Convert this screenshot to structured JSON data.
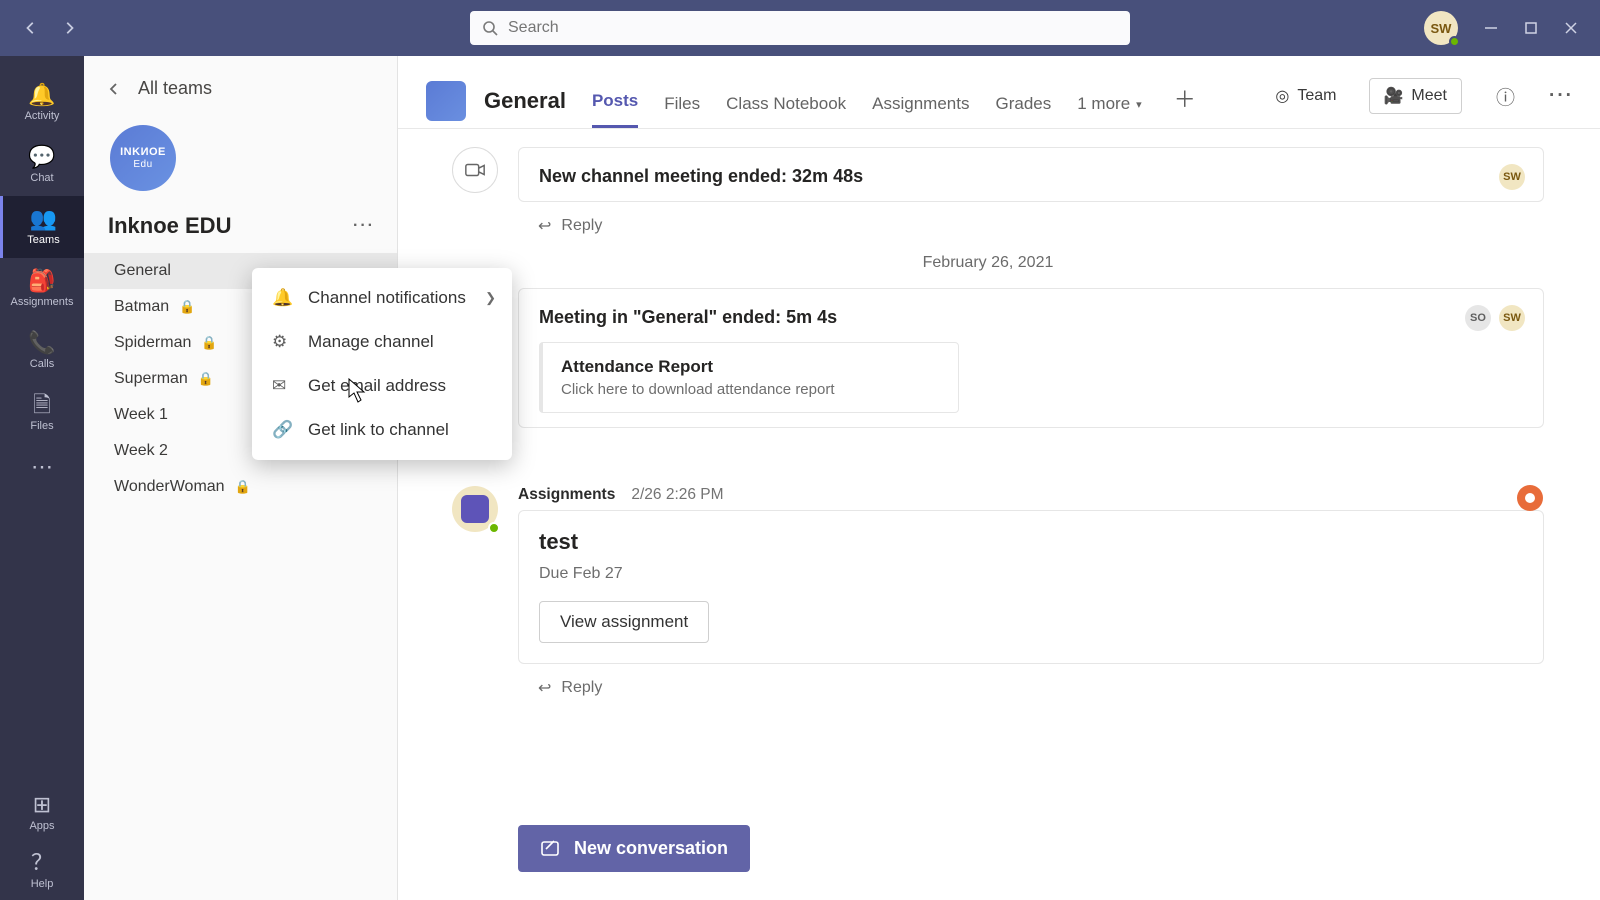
{
  "titlebar": {
    "search_placeholder": "Search",
    "avatar_initials": "SW"
  },
  "rail": {
    "activity": "Activity",
    "chat": "Chat",
    "teams": "Teams",
    "assignments": "Assignments",
    "calls": "Calls",
    "files": "Files",
    "apps": "Apps",
    "help": "Help"
  },
  "pane": {
    "all_teams": "All teams",
    "team_logo_top": "INKИOE",
    "team_logo_bottom": "Edu",
    "team_name": "Inknoe EDU"
  },
  "channels": [
    {
      "name": "General",
      "locked": false,
      "selected": true
    },
    {
      "name": "Batman",
      "locked": true,
      "selected": false
    },
    {
      "name": "Spiderman",
      "locked": true,
      "selected": false
    },
    {
      "name": "Superman",
      "locked": true,
      "selected": false
    },
    {
      "name": "Week 1",
      "locked": false,
      "selected": false
    },
    {
      "name": "Week 2",
      "locked": false,
      "selected": false
    },
    {
      "name": "WonderWoman",
      "locked": true,
      "selected": false
    }
  ],
  "context_menu": [
    {
      "icon": "bell",
      "label": "Channel notifications",
      "submenu": true
    },
    {
      "icon": "gear",
      "label": "Manage channel",
      "submenu": false
    },
    {
      "icon": "mail",
      "label": "Get email address",
      "submenu": false
    },
    {
      "icon": "link",
      "label": "Get link to channel",
      "submenu": false
    }
  ],
  "header": {
    "title": "General",
    "tabs": {
      "posts": "Posts",
      "files": "Files",
      "notebook": "Class Notebook",
      "assignments": "Assignments",
      "grades": "Grades",
      "more_label": "1 more"
    },
    "team_btn": "Team",
    "meet_btn": "Meet"
  },
  "feed": {
    "msg1_title": "New channel meeting ended: 32m 48s",
    "reply": "Reply",
    "date": "February 26, 2021",
    "msg2_title": "Meeting in \"General\" ended: 5m 4s",
    "attach_title": "Attendance Report",
    "attach_sub": "Click here to download attendance report",
    "asgn_sender": "Assignments",
    "asgn_time": "2/26 2:26 PM",
    "asgn_title": "test",
    "asgn_due": "Due Feb 27",
    "view_btn": "View assignment",
    "newconv": "New conversation",
    "badge_sw": "SW",
    "badge_so": "SO"
  }
}
